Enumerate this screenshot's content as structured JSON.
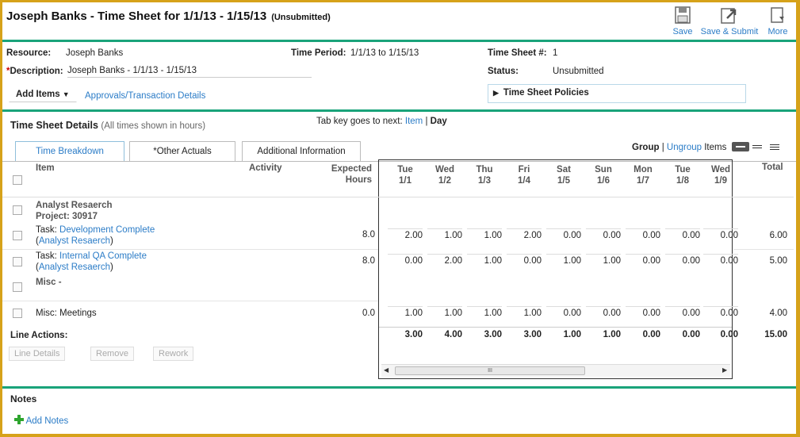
{
  "header": {
    "title": "Joseph Banks - Time Sheet for 1/1/13 - 1/15/13",
    "status_badge": "(Unsubmitted)",
    "toolbar": {
      "save": "Save",
      "save_submit": "Save & Submit",
      "more": "More"
    }
  },
  "info": {
    "resource_label": "Resource:",
    "resource_value": "Joseph Banks",
    "description_required": "*",
    "description_label": "Description:",
    "description_value": "Joseph Banks - 1/1/13 - 1/15/13",
    "period_label": "Time Period:",
    "period_value": "1/1/13 to 1/15/13",
    "sheet_no_label": "Time Sheet #:",
    "sheet_no_value": "1",
    "status_label": "Status:",
    "status_value": "Unsubmitted",
    "add_items": "Add Items",
    "approvals_link": "Approvals/Transaction Details",
    "policies": "Time Sheet Policies"
  },
  "details": {
    "title": "Time Sheet Details",
    "note": "(All times shown in hours)",
    "tab_key_text": "Tab key goes to next:",
    "tab_key_item": "Item",
    "tab_key_sep": "|",
    "tab_key_day": "Day",
    "tabs": [
      "Time Breakdown",
      "*Other Actuals",
      "Additional Information"
    ],
    "group_label": "Group",
    "group_sep": "|",
    "ungroup_label": "Ungroup",
    "items_label": "Items"
  },
  "grid": {
    "col_item": "Item",
    "col_activity": "Activity",
    "col_expected_1": "Expected",
    "col_expected_2": "Hours",
    "col_total": "Total",
    "days": [
      {
        "dow": "Tue",
        "date": "1/1"
      },
      {
        "dow": "Wed",
        "date": "1/2"
      },
      {
        "dow": "Thu",
        "date": "1/3"
      },
      {
        "dow": "Fri",
        "date": "1/4"
      },
      {
        "dow": "Sat",
        "date": "1/5"
      },
      {
        "dow": "Sun",
        "date": "1/6"
      },
      {
        "dow": "Mon",
        "date": "1/7"
      },
      {
        "dow": "Tue",
        "date": "1/8"
      },
      {
        "dow": "Wed",
        "date": "1/9"
      }
    ],
    "group_name": "Analyst Resaerch",
    "group_project": "Project: 30917",
    "rows": [
      {
        "prefix": "Task:",
        "name": "Development Complete",
        "paren_open": "(",
        "parent": "Analyst Resaerch",
        "paren_close": ")",
        "expected": "8.0",
        "values": [
          "2.00",
          "1.00",
          "1.00",
          "2.00",
          "0.00",
          "0.00",
          "0.00",
          "0.00",
          "0.00"
        ],
        "total": "6.00"
      },
      {
        "prefix": "Task:",
        "name": "Internal QA Complete",
        "paren_open": "(",
        "parent": "Analyst Resaerch",
        "paren_close": ")",
        "expected": "8.0",
        "values": [
          "0.00",
          "2.00",
          "1.00",
          "0.00",
          "1.00",
          "1.00",
          "0.00",
          "0.00",
          "0.00"
        ],
        "total": "5.00"
      }
    ],
    "misc_label": "Misc -",
    "misc_row": {
      "name": "Misc: Meetings",
      "expected": "0.0",
      "values": [
        "1.00",
        "1.00",
        "1.00",
        "1.00",
        "0.00",
        "0.00",
        "0.00",
        "0.00",
        "0.00"
      ],
      "total": "4.00"
    },
    "totals": [
      "3.00",
      "4.00",
      "3.00",
      "3.00",
      "1.00",
      "1.00",
      "0.00",
      "0.00",
      "0.00"
    ],
    "grand_total": "15.00",
    "line_actions": "Line Actions:",
    "line_details": "Line Details",
    "remove": "Remove",
    "rework": "Rework",
    "scroll_thumb": "III"
  },
  "notes": {
    "title": "Notes",
    "add_notes": "Add Notes"
  },
  "colors": {
    "accent": "#2b7cc7",
    "rule": "#1aa37a",
    "frame": "#d6a21a"
  }
}
